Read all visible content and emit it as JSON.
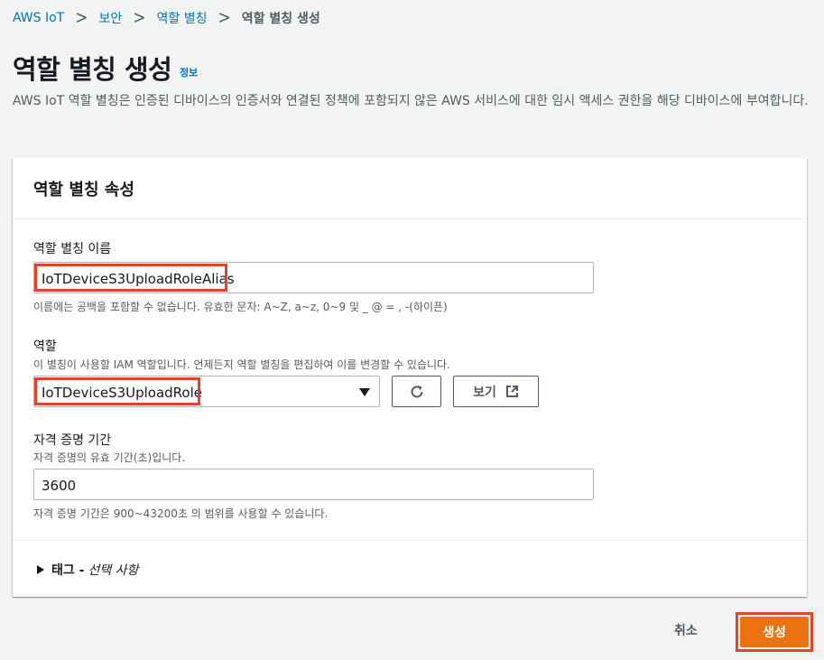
{
  "breadcrumb": {
    "items": [
      "AWS IoT",
      "보안",
      "역할 별칭"
    ],
    "current": "역할 별칭 생성"
  },
  "page": {
    "title": "역할 별칭 생성",
    "info_link": "정보",
    "description": "AWS IoT 역할 별칭은 인증된 디바이스의 인증서와 연결된 정책에 포함되지 않은 AWS 서비스에 대한 임시 액세스 권한을 해당 디바이스에 부여합니다."
  },
  "panel": {
    "title": "역할 별칭 속성",
    "alias_name": {
      "label": "역할 별칭 이름",
      "value": "IoTDeviceS3UploadRoleAlias",
      "hint": "이름에는 공백을 포함할 수 없습니다. 유효한 문자: A~Z, a~z, 0~9 및 _ @ = , -(하이픈)"
    },
    "role": {
      "label": "역할",
      "description": "이 별칭이 사용할 IAM 역할입니다. 언제든지 역할 별칭을 편집하여 이를 변경할 수 있습니다.",
      "selected": "IoTDeviceS3UploadRole",
      "view_button": "보기"
    },
    "duration": {
      "label": "자격 증명 기간",
      "description": "자격 증명의 유효 기간(초)입니다.",
      "value": "3600",
      "hint": "자격 증명 기간은 900~43200초 의 범위를 사용할 수 있습니다."
    },
    "tags": {
      "label": "태그 -",
      "optional": "선택 사항"
    }
  },
  "footer": {
    "cancel_label": "취소",
    "create_label": "생성"
  },
  "colors": {
    "link": "#0073bb",
    "primary_button": "#ec7211",
    "highlight": "#e0422a"
  }
}
